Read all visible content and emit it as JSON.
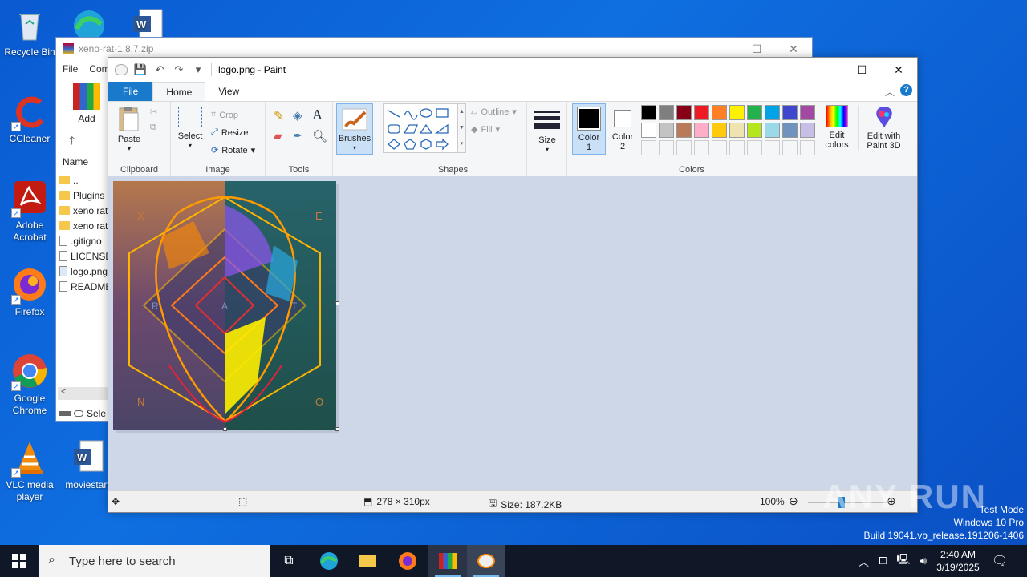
{
  "desktop": {
    "icons": [
      {
        "label": "Recycle Bin"
      },
      {
        "label": "CCleaner"
      },
      {
        "label": "Adobe Acrobat"
      },
      {
        "label": "Firefox"
      },
      {
        "label": "Google Chrome"
      },
      {
        "label": "VLC media player"
      },
      {
        "label": "moviestart"
      }
    ]
  },
  "winrar": {
    "title": "xeno-rat-1.8.7.zip",
    "menu": [
      "File",
      "Com"
    ],
    "add_label": "Add",
    "name_header": "Name",
    "files": [
      "..",
      "Plugins",
      "xeno rat",
      "xeno rat",
      ".gitigno",
      "LICENSE",
      "logo.png",
      "README"
    ],
    "status": "Sele"
  },
  "paint": {
    "title": "logo.png - Paint",
    "tabs": [
      "File",
      "Home",
      "View"
    ],
    "groups": {
      "clipboard": {
        "label": "Clipboard",
        "paste": "Paste"
      },
      "image": {
        "label": "Image",
        "select": "Select",
        "crop": "Crop",
        "resize": "Resize",
        "rotate": "Rotate"
      },
      "tools": {
        "label": "Tools"
      },
      "brushes": {
        "label": "Brushes"
      },
      "shapes": {
        "label": "Shapes",
        "outline": "Outline",
        "fill": "Fill"
      },
      "size": {
        "label": "Size"
      },
      "colors": {
        "label": "Colors",
        "color1": "Color 1",
        "color2": "Color 2",
        "edit": "Edit colors"
      },
      "paint3d": {
        "label": "Edit with Paint 3D"
      }
    },
    "palette": [
      "#000000",
      "#7f7f7f",
      "#880015",
      "#ed1c24",
      "#ff7f27",
      "#fff200",
      "#22b14c",
      "#00a2e8",
      "#3f48cc",
      "#a349a4",
      "#ffffff",
      "#c3c3c3",
      "#b97a57",
      "#ffaec9",
      "#ffc90e",
      "#efe4b0",
      "#b5e61d",
      "#99d9ea",
      "#7092be",
      "#c8bfe7"
    ],
    "status": {
      "dimensions": "278 × 310px",
      "size": "Size: 187.2KB",
      "zoom": "100%"
    },
    "logo_letters": [
      "X",
      "E",
      "R",
      "A",
      "T",
      "N",
      "O"
    ]
  },
  "taskbar": {
    "search_placeholder": "Type here to search",
    "time": "2:40 AM",
    "date": "3/19/2025"
  },
  "watermark": {
    "line1": "Test Mode",
    "line2": "Windows 10 Pro",
    "line3": "Build 19041.vb_release.191206-1406",
    "brand": "ANY RUN"
  }
}
